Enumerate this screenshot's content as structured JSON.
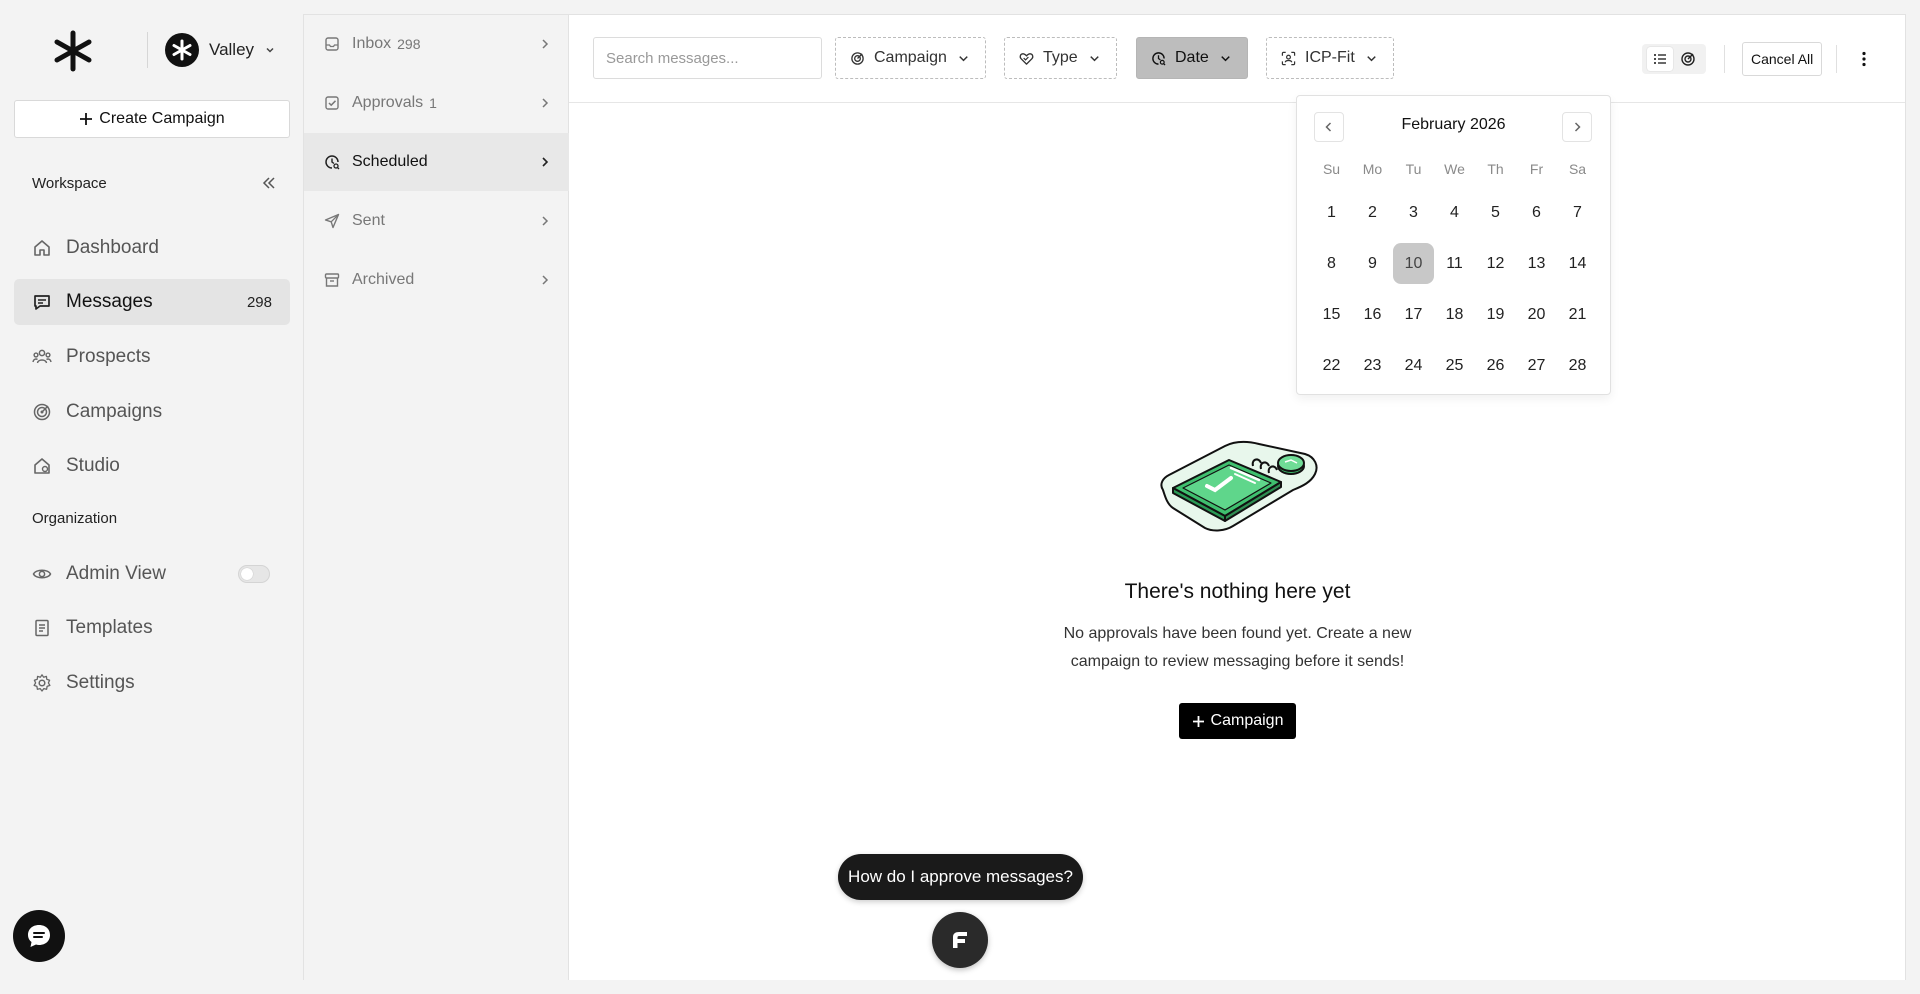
{
  "workspace": {
    "name": "Valley"
  },
  "sidebar": {
    "create_label": "Create Campaign",
    "workspace_heading": "Workspace",
    "organization_heading": "Organization",
    "items": [
      {
        "label": "Dashboard",
        "icon": "home-icon"
      },
      {
        "label": "Messages",
        "icon": "message-icon",
        "count": "298",
        "active": true
      },
      {
        "label": "Prospects",
        "icon": "users-icon"
      },
      {
        "label": "Campaigns",
        "icon": "target-icon"
      },
      {
        "label": "Studio",
        "icon": "studio-icon"
      }
    ],
    "org_items": [
      {
        "label": "Admin View",
        "icon": "eye-icon",
        "toggle": false
      },
      {
        "label": "Templates",
        "icon": "document-icon"
      },
      {
        "label": "Settings",
        "icon": "gear-icon"
      }
    ]
  },
  "folders": [
    {
      "label": "Inbox",
      "count": "298"
    },
    {
      "label": "Approvals",
      "count": "1"
    },
    {
      "label": "Scheduled",
      "count": "",
      "active": true
    },
    {
      "label": "Sent",
      "count": ""
    },
    {
      "label": "Archived",
      "count": ""
    }
  ],
  "toolbar": {
    "search_placeholder": "Search messages...",
    "filters": {
      "campaign": "Campaign",
      "type": "Type",
      "date": "Date",
      "icp": "ICP-Fit"
    },
    "cancel_all": "Cancel All"
  },
  "calendar": {
    "title": "February 2026",
    "weekdays": [
      "Su",
      "Mo",
      "Tu",
      "We",
      "Th",
      "Fr",
      "Sa"
    ],
    "weeks": [
      [
        "1",
        "2",
        "3",
        "4",
        "5",
        "6",
        "7"
      ],
      [
        "8",
        "9",
        "10",
        "11",
        "12",
        "13",
        "14"
      ],
      [
        "15",
        "16",
        "17",
        "18",
        "19",
        "20",
        "21"
      ],
      [
        "22",
        "23",
        "24",
        "25",
        "26",
        "27",
        "28"
      ]
    ],
    "selected": "10"
  },
  "empty_state": {
    "title": "There's nothing here yet",
    "description": "No approvals have been found yet. Create a new campaign to review messaging before it sends!",
    "cta": "Campaign"
  },
  "help": {
    "prompt": "How do I approve messages?"
  },
  "colors": {
    "accent": "#000000",
    "illustration_green": "#3fbf6e",
    "selected_day": "#c8c8c8"
  }
}
